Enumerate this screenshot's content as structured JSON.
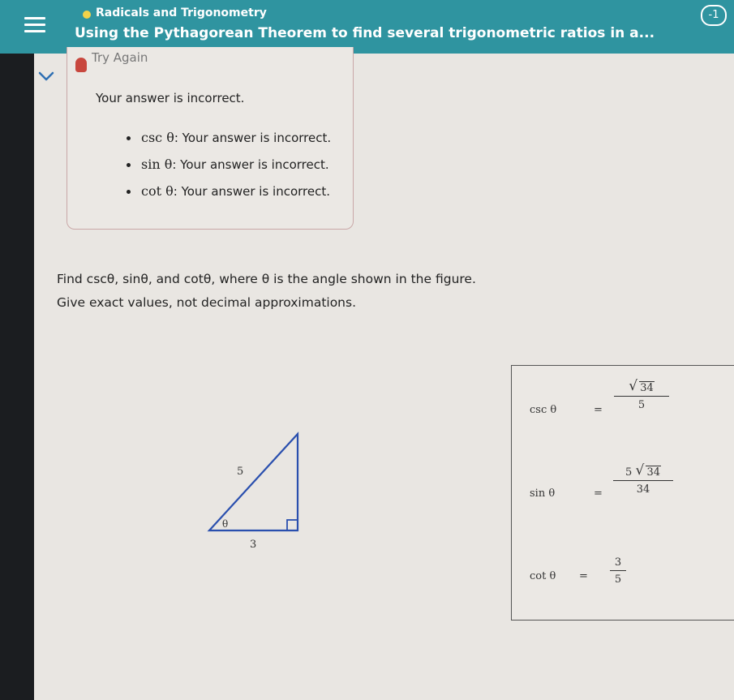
{
  "header": {
    "topic": "Radicals and Trigonometry",
    "title": "Using the Pythagorean Theorem to find several trigonometric ratios in a...",
    "counter": "-1",
    "accent_color": "#2f94a0",
    "dot_color": "#f2d24a"
  },
  "feedback": {
    "status": "Try Again",
    "message": "Your answer is incorrect.",
    "items": [
      {
        "fn": "csc θ",
        "text": ": Your answer is incorrect."
      },
      {
        "fn": "sin θ",
        "text": ": Your answer is incorrect."
      },
      {
        "fn": "cot θ",
        "text": ": Your answer is incorrect."
      }
    ],
    "icons": [
      "chevron-down-icon",
      "alert-icon"
    ]
  },
  "question": {
    "line1": "Find cscθ, sinθ, and cotθ, where θ is the angle shown in the figure.",
    "line2": "Give exact values, not decimal approximations."
  },
  "figure": {
    "hypotenuse": "5",
    "base": "3",
    "angle": "θ"
  },
  "answers": {
    "csc": {
      "label": "csc θ",
      "eq": "=",
      "num_coef": "",
      "num_radicand": "34",
      "den": "5"
    },
    "sin": {
      "label": "sin θ",
      "eq": "=",
      "num_coef": "5",
      "num_radicand": "34",
      "den": "34"
    },
    "cot": {
      "label": "cot θ",
      "eq": "=",
      "num": "3",
      "den": "5"
    }
  }
}
